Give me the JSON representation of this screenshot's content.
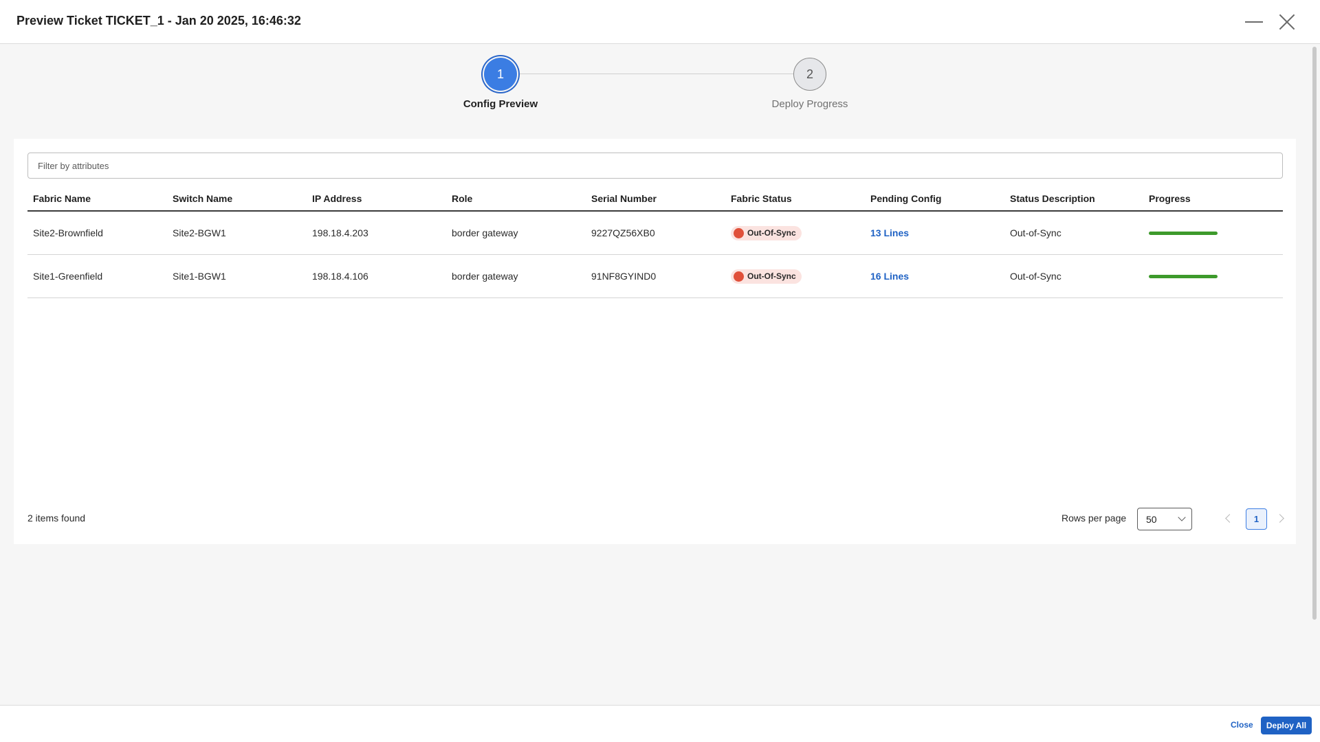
{
  "header": {
    "title": "Preview Ticket TICKET_1 - Jan 20 2025, 16:46:32"
  },
  "stepper": {
    "steps": [
      {
        "number": "1",
        "label": "Config Preview",
        "state": "active"
      },
      {
        "number": "2",
        "label": "Deploy Progress",
        "state": "inactive"
      }
    ]
  },
  "filter": {
    "placeholder": "Filter by attributes"
  },
  "table": {
    "columns": [
      "Fabric Name",
      "Switch Name",
      "IP Address",
      "Role",
      "Serial Number",
      "Fabric Status",
      "Pending Config",
      "Status Description",
      "Progress"
    ],
    "rows": [
      {
        "fabric_name": "Site2-Brownfield",
        "switch_name": "Site2-BGW1",
        "ip_address": "198.18.4.203",
        "role": "border gateway",
        "serial_number": "9227QZ56XB0",
        "fabric_status": "Out-Of-Sync",
        "pending_config": "13 Lines",
        "status_description": "Out-of-Sync",
        "progress": 1.0
      },
      {
        "fabric_name": "Site1-Greenfield",
        "switch_name": "Site1-BGW1",
        "ip_address": "198.18.4.106",
        "role": "border gateway",
        "serial_number": "91NF8GYIND0",
        "fabric_status": "Out-Of-Sync",
        "pending_config": "16 Lines",
        "status_description": "Out-of-Sync",
        "progress": 1.0
      }
    ]
  },
  "pagination": {
    "items_found": "2 items found",
    "rows_per_page_label": "Rows per page",
    "rows_per_page_value": "50",
    "current_page": "1"
  },
  "footer": {
    "close_label": "Close",
    "deploy_label": "Deploy All"
  },
  "colors": {
    "accent": "#1f62c4",
    "step_active": "#3b7de3",
    "status_error": "#e0503a",
    "progress": "#3d9a2b"
  }
}
